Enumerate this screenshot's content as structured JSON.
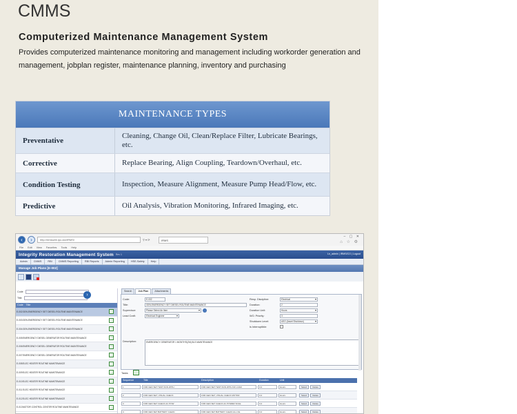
{
  "brochure": {
    "title": "CMMS",
    "subtitle": "Computerized Maintenance Management System",
    "description": "Provides computerized maintenance monitoring and management including workorder generation and management, jobplan register, maintenance planning, inventory and purchasing"
  },
  "maintenance_types": {
    "header": "MAINTENANCE TYPES",
    "rows": [
      {
        "name": "Preventative",
        "value": "Cleaning, Change Oil, Clean/Replace Filter,  Lubricate Bearings, etc."
      },
      {
        "name": "Corrective",
        "value": "Replace Bearing, Align Coupling, Teardown/Overhaul, etc."
      },
      {
        "name": "Condition Testing",
        "value": "Inspection, Measure Alignment, Measure Pump Head/Flow, etc."
      },
      {
        "name": "Predictive",
        "value": "Oil Analysis, Vibration Monitoring, Infrared Imaging, etc."
      }
    ]
  },
  "browser": {
    "address": "http://irmsweb.ipc-lan/IRMS/",
    "tab_label": "IRMS",
    "menu": [
      "File",
      "Edit",
      "View",
      "Favorites",
      "Tools",
      "Help"
    ],
    "app_title": "Integrity Restoration Management System",
    "app_version": "Rev 1",
    "user_links": "Ln_admin | IRMS/CO | Logout",
    "nav": [
      "Admin",
      "CMMS",
      "RBI",
      "CMMS Reporting",
      "RBI Reports",
      "Admin Reporting",
      "HSE-Safety",
      "Help"
    ],
    "page_title": "Manage Job Plans [E-002]",
    "left": {
      "code_label": "Code",
      "title_label": "Title",
      "col_code": "Code",
      "col_title": "Title",
      "rows": [
        {
          "code": "E-002",
          "title": "GEN.EMERGENCY SET DIESEL ROUTINE MAINTENANCE"
        },
        {
          "code": "E-003",
          "title": "GEN.EMERGENCY SET DIESEL ROUTINE MAINTENANCE"
        },
        {
          "code": "E-004",
          "title": "GEN.EMERGENCY SET DIESEL ROUTINE MAINTENANCE"
        },
        {
          "code": "E-005",
          "title": "EMERGENCY DIESEL GENERATOR ROUTINE MAINTENANCE"
        },
        {
          "code": "E-006",
          "title": "EMERGENCY DIESEL GENERATOR ROUTINE MAINTENANCE"
        },
        {
          "code": "E-007",
          "title": "EMERGENCY DIESEL GENERATOR ROUTINE MAINTENANCE"
        },
        {
          "code": "E-008",
          "title": "ELEC HEATER ROUTINE MAINTENANCE"
        },
        {
          "code": "E-009",
          "title": "ELEC HEATER ROUTINE MAINTENANCE"
        },
        {
          "code": "E-010",
          "title": "ELEC HEATER ROUTINE MAINTENANCE"
        },
        {
          "code": "E-011",
          "title": "ELEC HEATER ROUTINE MAINTENANCE"
        },
        {
          "code": "E-012",
          "title": "ELEC HEATER ROUTINE MAINTENANCE"
        },
        {
          "code": "E-013",
          "title": "MOTOR CONTROL CENTER ROUTINE MAINTENANCE"
        }
      ]
    },
    "form": {
      "tabs": [
        "Search",
        "Job Plan",
        "Attachments"
      ],
      "code_label": "Code:",
      "code_value": "E-002",
      "title_label": "Title:",
      "title_value": "GEN.EMERGENCY SET DIESEL ROUTINE MAINTENANCE",
      "supervisor_label": "Supervisor:",
      "supervisor_value": "Please Select An Item",
      "lead_craft_label": "Lead Craft:",
      "lead_craft_value": "Electrical Engineer",
      "resp_label": "Resp. Discipline:",
      "resp_value": "Electrical",
      "duration_label": "Duration:",
      "duration_value": "2",
      "duration_unit_label": "Duration Unit:",
      "duration_unit_value": "Hours",
      "wo_priority_label": "WO. Priority:",
      "wo_priority_value": "3",
      "shutdown_label": "Shutdown Level:",
      "shutdown_value": "ASO (Asset Shutdown)",
      "interruptible_label": "Is Interruptible:",
      "description_label": "Description:",
      "description_value": "EMERGENCY GENERATOR 1 MONTH'S(2M) 8LS MAINTENANCE"
    },
    "tasks": {
      "label": "Tasks",
      "headers": [
        "Sequence",
        "Title",
        "Description",
        "Duration",
        "Unit"
      ],
      "select_label": "Select",
      "delete_label": "Delete",
      "rows": [
        {
          "seq": "1",
          "title": "FOR GEN SET TEST RUN WITH",
          "desc": "FOR GEN SET TEST RUN WITH NO LOAD",
          "dur": "0.2",
          "unit": "Hours"
        },
        {
          "seq": "2",
          "title": "FOR GEN SET, VISUAL CHECK",
          "desc": "FOR GEN SET, VISUAL CHECK MOTOR",
          "dur": "0.2",
          "unit": "Hours"
        },
        {
          "seq": "3",
          "title": "FOR GEN SET CHECK AC POW",
          "desc": "FOR GEN SET CHECK AC POWER SOLE",
          "dur": "0.2",
          "unit": "Hours"
        },
        {
          "seq": "4",
          "title": "FOR GEN SET BATTERY CLEAN",
          "desc": "FOR GEN SET BATTERY CLEAN ALL CE",
          "dur": "0.2",
          "unit": "Hours"
        }
      ]
    }
  }
}
